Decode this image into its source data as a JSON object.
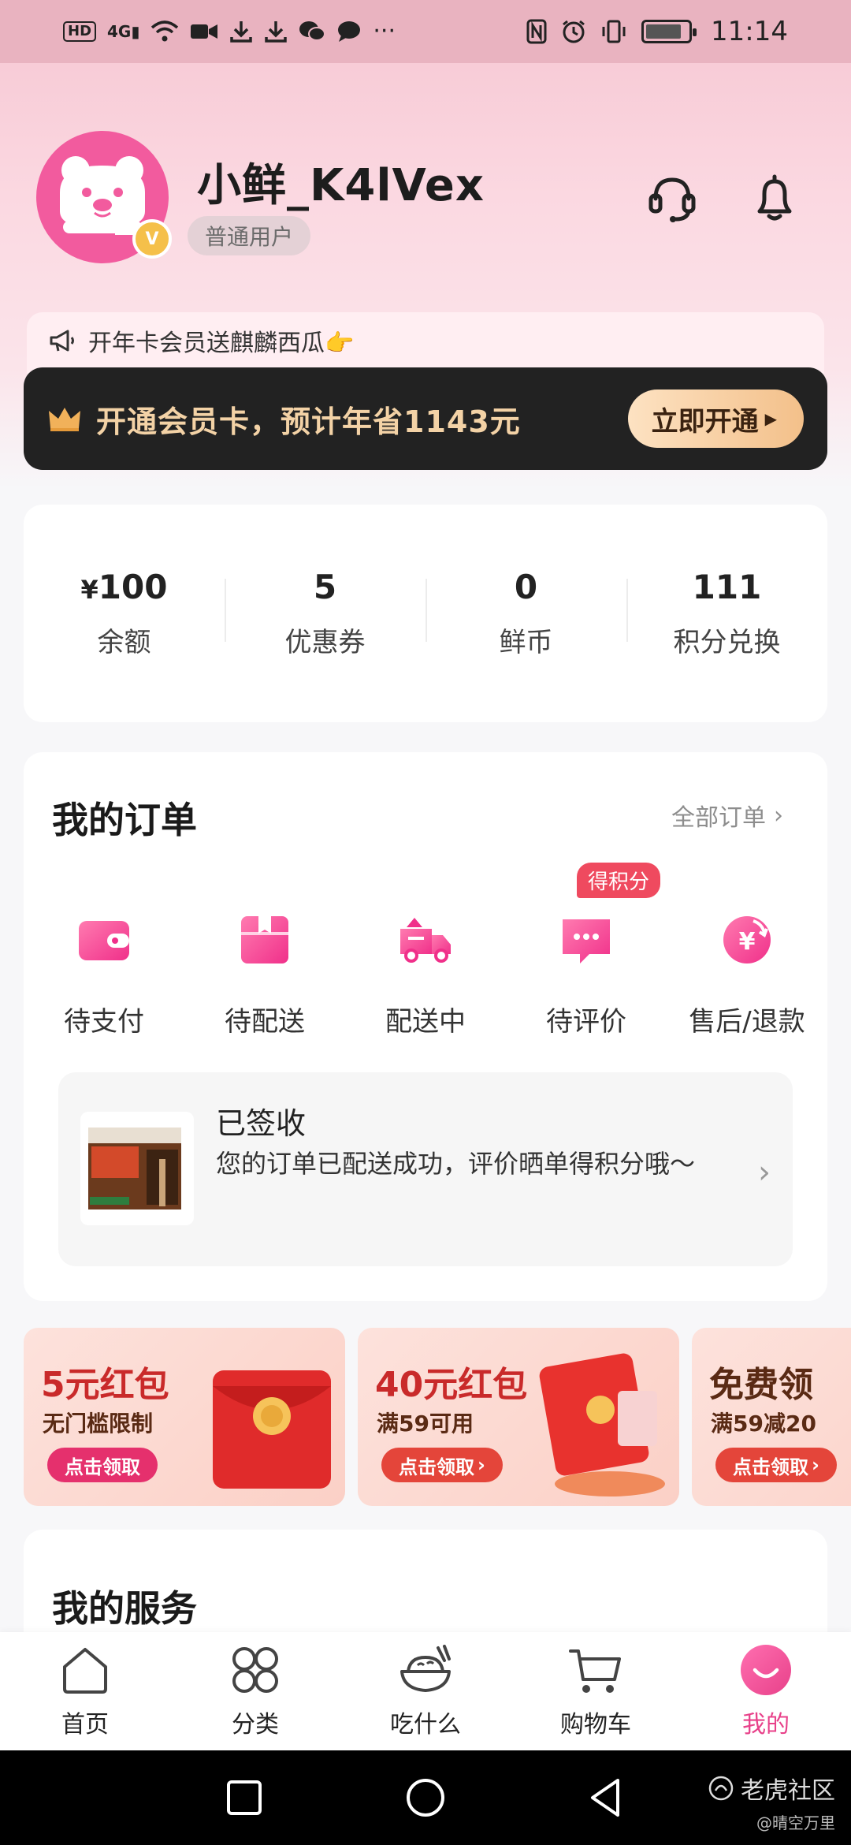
{
  "status_bar": {
    "hd": "HD",
    "network": "4G",
    "time": "11:14"
  },
  "profile": {
    "username": "小鲜_K4lVex",
    "level": "普通用户",
    "badge": "V"
  },
  "promo": {
    "text": "开年卡会员送麒麟西瓜👉"
  },
  "vip": {
    "text": "开通会员卡，预计年省1143元",
    "button": "立即开通"
  },
  "assets": [
    {
      "currency": "¥",
      "value": "100",
      "label": "余额"
    },
    {
      "currency": "",
      "value": "5",
      "label": "优惠券"
    },
    {
      "currency": "",
      "value": "0",
      "label": "鲜币"
    },
    {
      "currency": "",
      "value": "111",
      "label": "积分兑换"
    }
  ],
  "orders": {
    "title": "我的订单",
    "all_link": "全部订单",
    "items": [
      {
        "label": "待支付",
        "icon": "wallet-icon"
      },
      {
        "label": "待配送",
        "icon": "package-icon"
      },
      {
        "label": "配送中",
        "icon": "delivery-truck-icon"
      },
      {
        "label": "待评价",
        "icon": "comment-icon",
        "tag": "得积分"
      },
      {
        "label": "售后/退款",
        "icon": "refund-icon"
      }
    ],
    "latest": {
      "status": "已签收",
      "desc": "您的订单已配送成功，评价晒单得积分哦～"
    }
  },
  "coupons": [
    {
      "title": "5元红包",
      "sub": "无门槛限制",
      "button": "点击领取"
    },
    {
      "title": "40元红包",
      "sub": "满59可用",
      "button": "点击领取"
    },
    {
      "title": "免费领",
      "sub": "满59减20",
      "button": "点击领取"
    }
  ],
  "services": {
    "title": "我的服务"
  },
  "tabbar": [
    {
      "label": "首页",
      "icon": "home-icon"
    },
    {
      "label": "分类",
      "icon": "grid-icon"
    },
    {
      "label": "吃什么",
      "icon": "bowl-icon"
    },
    {
      "label": "购物车",
      "icon": "cart-icon"
    },
    {
      "label": "我的",
      "icon": "profile-face-icon",
      "active": true
    }
  ],
  "watermark": {
    "brand": "老虎社区",
    "user": "@晴空万里"
  },
  "colors": {
    "accent": "#e8418a",
    "vip_banner": "#222222",
    "vip_gold": "#f3d2a6"
  }
}
